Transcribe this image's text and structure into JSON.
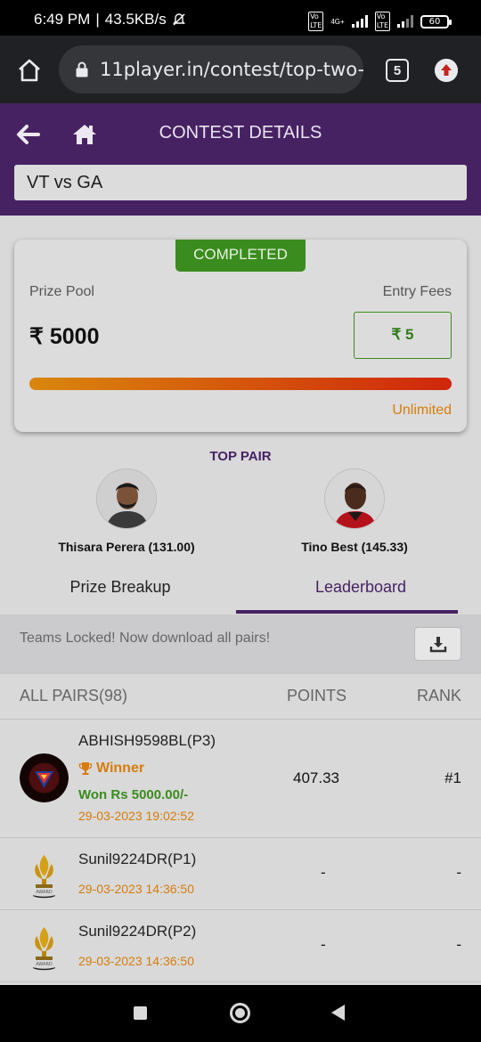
{
  "status_bar": {
    "time": "6:49 PM",
    "speed": "43.5KB/s",
    "network1": "4G+",
    "battery": "60"
  },
  "browser": {
    "url": "11player.in/contest/top-two-p",
    "tab_count": "5",
    "icons": [
      "home-icon",
      "lock-icon",
      "tabs-icon",
      "update-icon"
    ]
  },
  "header": {
    "title": "CONTEST DETAILS",
    "match": "VT vs GA"
  },
  "contest": {
    "status": "COMPLETED",
    "prize_pool_label": "Prize Pool",
    "entry_fees_label": "Entry Fees",
    "prize_pool_value": "₹ 5000",
    "entry_fee_value": "₹ 5",
    "progress_fraction": 1.0,
    "spots_label": "Unlimited"
  },
  "top_pair": {
    "title": "TOP PAIR",
    "players": [
      {
        "name": "Thisara Perera (131.00)"
      },
      {
        "name": "Tino Best (145.33)"
      }
    ]
  },
  "tabs": [
    {
      "label": "Prize Breakup",
      "active": false
    },
    {
      "label": "Leaderboard",
      "active": true
    }
  ],
  "locked_banner": {
    "text": "Teams Locked! Now download all pairs!"
  },
  "leaderboard": {
    "col_pairs": "ALL PAIRS(98)",
    "col_points": "POINTS",
    "col_rank": "RANK",
    "rows": [
      {
        "user": "ABHISH9598BL(P3)",
        "winner": "Winner",
        "won": "Won Rs 5000.00/-",
        "date": "29-03-2023 19:02:52",
        "points": "407.33",
        "rank": "#1"
      },
      {
        "user": "Sunil9224DR(P1)",
        "date": "29-03-2023 14:36:50",
        "points": "-",
        "rank": "-"
      },
      {
        "user": "Sunil9224DR(P2)",
        "date": "29-03-2023 14:36:50",
        "points": "-",
        "rank": "-"
      }
    ]
  },
  "colors": {
    "primary": "#472263",
    "success": "#3a8c1e",
    "accent": "#d67c0c"
  }
}
